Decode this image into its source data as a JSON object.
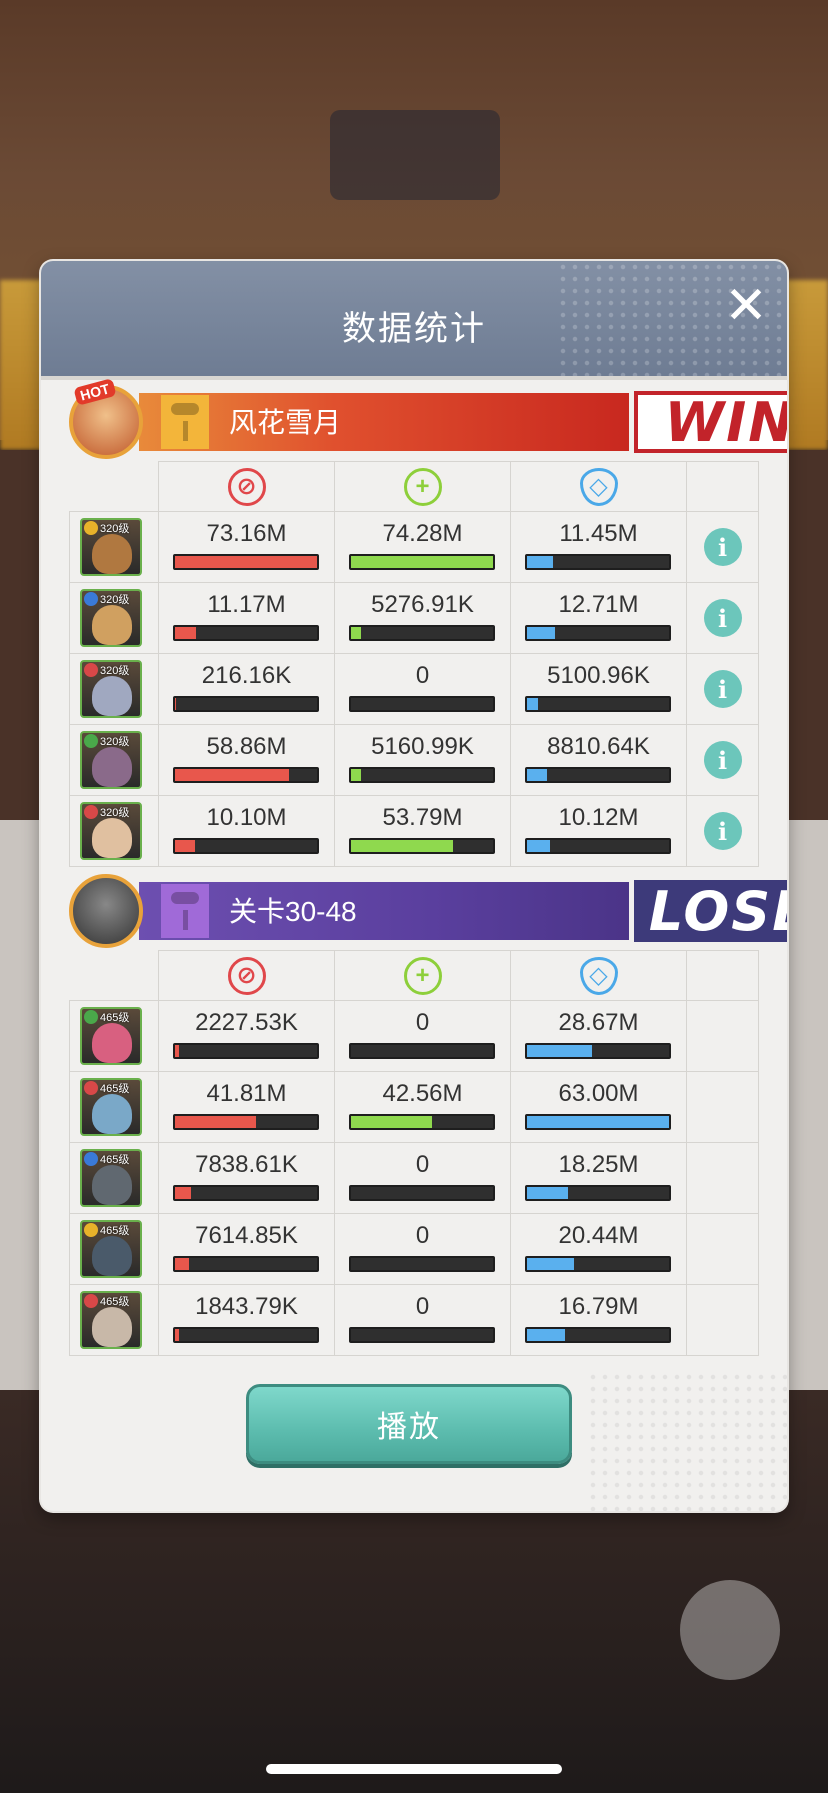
{
  "dialog": {
    "title": "数据统计",
    "close_icon": "close-icon",
    "play_label": "播放"
  },
  "stat_icons": [
    "sword-icon",
    "heal-icon",
    "shield-icon"
  ],
  "colors": {
    "damage": "#e8574c",
    "heal": "#8fd94e",
    "defense": "#5ab0ee",
    "win": "#c2232a",
    "lose": "#3d3a7a",
    "info": "#6cc6bb"
  },
  "teams": [
    {
      "name": "风花雪月",
      "result": "WIN",
      "badge": "HOT",
      "heroes": [
        {
          "level": "320级",
          "damage": "73.16M",
          "damage_pct": 100,
          "heal": "74.28M",
          "heal_pct": 100,
          "defense": "11.45M",
          "defense_pct": 18,
          "info": "i",
          "faction_color": "#e8b22a",
          "face_color": "#b07840"
        },
        {
          "level": "320级",
          "damage": "11.17M",
          "damage_pct": 15,
          "heal": "5276.91K",
          "heal_pct": 7,
          "defense": "12.71M",
          "defense_pct": 20,
          "info": "i",
          "faction_color": "#3a7ad8",
          "face_color": "#d0a060"
        },
        {
          "level": "320级",
          "damage": "216.16K",
          "damage_pct": 1,
          "heal": "0",
          "heal_pct": 0,
          "defense": "5100.96K",
          "defense_pct": 8,
          "info": "i",
          "faction_color": "#d84848",
          "face_color": "#a0a8c0"
        },
        {
          "level": "320级",
          "damage": "58.86M",
          "damage_pct": 80,
          "heal": "5160.99K",
          "heal_pct": 7,
          "defense": "8810.64K",
          "defense_pct": 14,
          "info": "i",
          "faction_color": "#4aa84a",
          "face_color": "#8a6a8a"
        },
        {
          "level": "320级",
          "damage": "10.10M",
          "damage_pct": 14,
          "heal": "53.79M",
          "heal_pct": 72,
          "defense": "10.12M",
          "defense_pct": 16,
          "info": "i",
          "faction_color": "#d84848",
          "face_color": "#e0c0a0"
        }
      ]
    },
    {
      "name": "关卡30-48",
      "result": "LOSE",
      "heroes": [
        {
          "level": "465级",
          "damage": "2227.53K",
          "damage_pct": 3,
          "heal": "0",
          "heal_pct": 0,
          "defense": "28.67M",
          "defense_pct": 46,
          "faction_color": "#4aa84a",
          "face_color": "#d86080"
        },
        {
          "level": "465级",
          "damage": "41.81M",
          "damage_pct": 57,
          "heal": "42.56M",
          "heal_pct": 57,
          "defense": "63.00M",
          "defense_pct": 100,
          "faction_color": "#d84848",
          "face_color": "#7aa8c8"
        },
        {
          "level": "465级",
          "damage": "7838.61K",
          "damage_pct": 11,
          "heal": "0",
          "heal_pct": 0,
          "defense": "18.25M",
          "defense_pct": 29,
          "faction_color": "#3a7ad8",
          "face_color": "#606870"
        },
        {
          "level": "465级",
          "damage": "7614.85K",
          "damage_pct": 10,
          "heal": "0",
          "heal_pct": 0,
          "defense": "20.44M",
          "defense_pct": 33,
          "faction_color": "#e8b22a",
          "face_color": "#4a5a6a"
        },
        {
          "level": "465级",
          "damage": "1843.79K",
          "damage_pct": 3,
          "heal": "0",
          "heal_pct": 0,
          "defense": "16.79M",
          "defense_pct": 27,
          "faction_color": "#d84848",
          "face_color": "#c8b8a8"
        }
      ]
    }
  ]
}
